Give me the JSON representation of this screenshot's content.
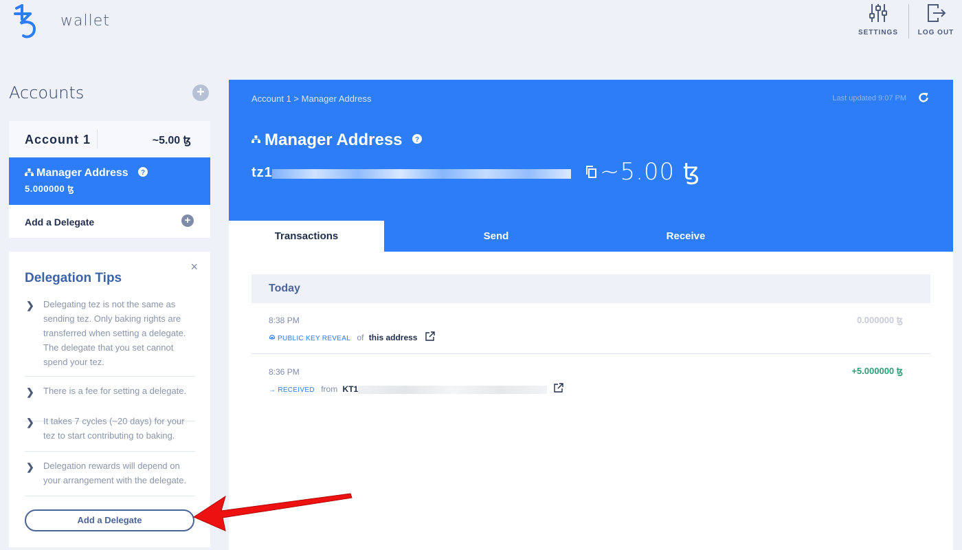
{
  "header": {
    "app_name": "wallet",
    "settings_label": "SETTINGS",
    "logout_label": "LOG OUT"
  },
  "sidebar": {
    "title": "Accounts",
    "account": {
      "name": "Account 1",
      "balance": "~5.00 ꜩ",
      "manager_label": "Manager Address",
      "manager_balance": "5.000000 ꜩ",
      "add_delegate_label": "Add a Delegate"
    },
    "tips": {
      "title": "Delegation Tips",
      "items": [
        "Delegating tez is not the same as sending tez. Only baking rights are transferred when setting a delegate. The delegate that you set cannot spend your tez.",
        "There is a fee for setting a delegate.",
        "It takes 7 cycles (~20 days) for your tez to start contributing to baking.",
        "Delegation rewards will depend on your arrangement with the delegate."
      ],
      "button_label": "Add a Delegate",
      "close_glyph": "×"
    }
  },
  "main": {
    "breadcrumb": "Account 1 > Manager Address",
    "last_updated": "Last updated 9:07 PM",
    "title": "Manager Address",
    "address_prefix": "tz1",
    "balance": "~5.00 ꜩ",
    "tabs": [
      {
        "label": "Transactions",
        "active": true
      },
      {
        "label": "Send",
        "active": false
      },
      {
        "label": "Receive",
        "active": false
      }
    ],
    "day_header": "Today",
    "transactions": [
      {
        "time": "8:38 PM",
        "amount": "0.000000 ꜩ",
        "kind": "PUBLIC KEY REVEAL",
        "preposition": "of",
        "target": "this address"
      },
      {
        "time": "8:36 PM",
        "amount": "+5.000000 ꜩ",
        "kind": "RECEIVED",
        "preposition": "from",
        "target": "KT1"
      }
    ]
  },
  "colors": {
    "accent": "#2c7df7",
    "page_bg": "#eef1f8",
    "positive": "#2d9d78",
    "annotation_arrow": "#ee1111"
  }
}
